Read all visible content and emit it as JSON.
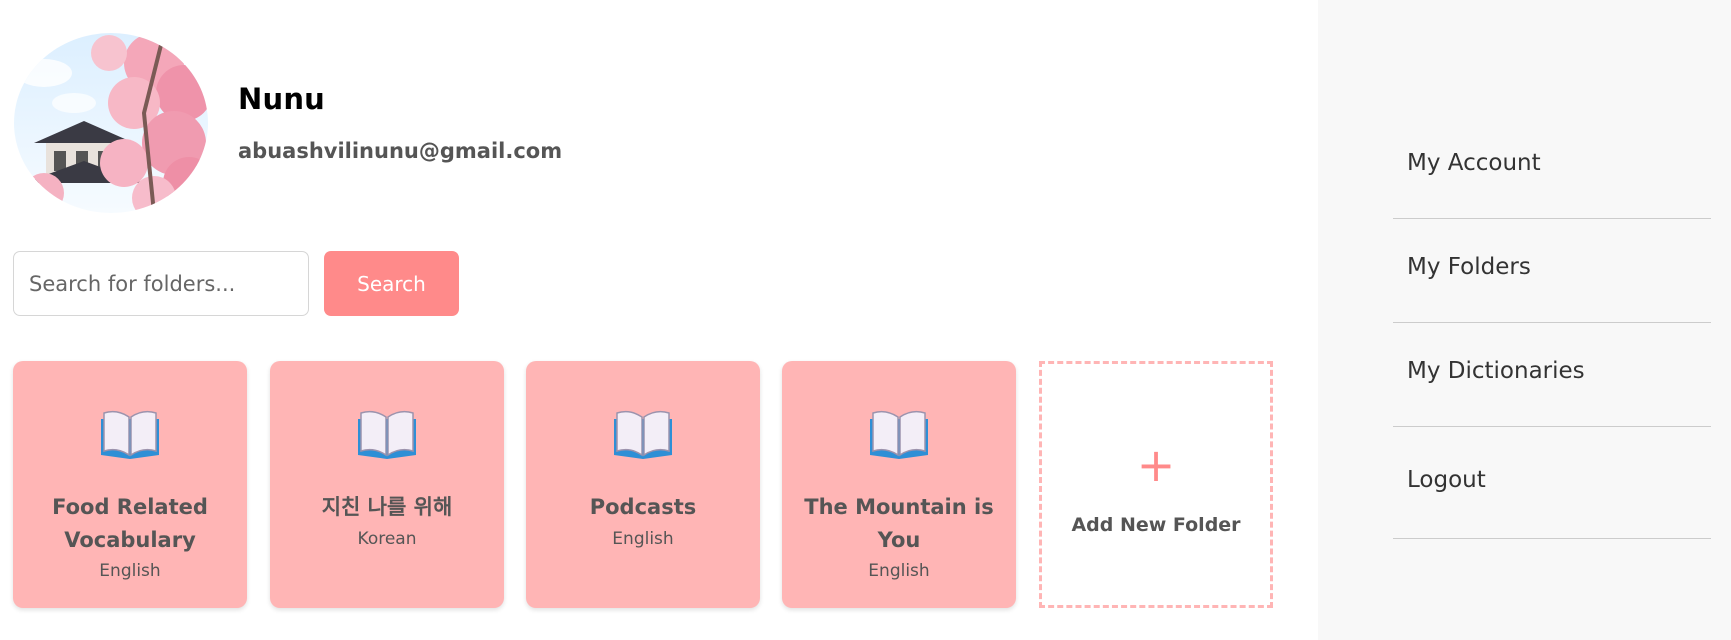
{
  "user": {
    "name": "Nunu",
    "email": "abuashvilinunu@gmail.com"
  },
  "search": {
    "placeholder": "Search for folders...",
    "value": "",
    "button_label": "Search"
  },
  "folders": [
    {
      "title": "Food Related Vocabulary",
      "language": "English",
      "icon": "open-book-icon"
    },
    {
      "title": "지친 나를 위해",
      "language": "Korean",
      "icon": "open-book-icon"
    },
    {
      "title": "Podcasts",
      "language": "English",
      "icon": "open-book-icon"
    },
    {
      "title": "The Mountain is You",
      "language": "English",
      "icon": "open-book-icon"
    }
  ],
  "add_folder": {
    "icon": "plus-icon",
    "symbol": "+",
    "label": "Add New Folder"
  },
  "sidebar": {
    "items": [
      {
        "label": "My Account"
      },
      {
        "label": "My Folders"
      },
      {
        "label": "My Dictionaries"
      },
      {
        "label": "Logout"
      }
    ]
  },
  "colors": {
    "accent": "#ff8a8a",
    "card": "#ffb5b5",
    "sidebar_bg": "#f8f8f8"
  }
}
